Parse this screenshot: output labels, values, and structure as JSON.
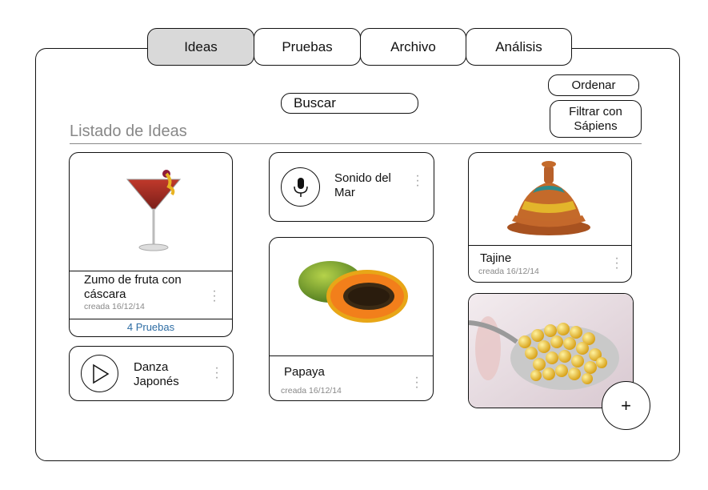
{
  "tabs": [
    {
      "label": "Ideas",
      "active": true
    },
    {
      "label": "Pruebas",
      "active": false
    },
    {
      "label": "Archivo",
      "active": false
    },
    {
      "label": "Análisis",
      "active": false
    }
  ],
  "toolbar": {
    "search_label": "Buscar",
    "sort_label": "Ordenar",
    "filter_label": "Filtrar con Sápiens"
  },
  "section_title": "Listado de Ideas",
  "cards": {
    "zumo": {
      "title": "Zumo de fruta con cáscara",
      "date": "creada 16/12/14",
      "pruebas": "4 Pruebas",
      "image": "cocktail-image"
    },
    "danza": {
      "title": "Danza Japonés",
      "icon": "play-icon"
    },
    "sonido": {
      "title": "Sonido del Mar",
      "icon": "microphone-icon"
    },
    "papaya": {
      "title": "Papaya",
      "date": "creada 16/12/14",
      "image": "papaya-image"
    },
    "tajine": {
      "title": "Tajine",
      "date": "creada 16/12/14",
      "image": "tajine-image"
    },
    "caviar": {
      "image": "spherification-spoon-image"
    }
  },
  "fab_label": "+",
  "colors": {
    "active_tab": "#d9d9d9",
    "link": "#2e6da4",
    "muted": "#888888"
  }
}
